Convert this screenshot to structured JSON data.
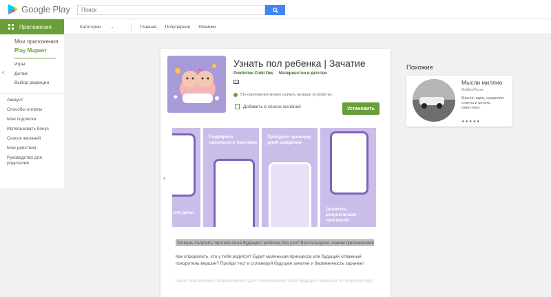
{
  "header": {
    "logo_text": "Google Play",
    "search_placeholder": "Поиск"
  },
  "subnav": {
    "apps_tab": "Приложения",
    "categories": "Категории",
    "links": [
      "Главная",
      "Популярное",
      "Новинки"
    ]
  },
  "sidebar": {
    "my_apps": "Мои приложения",
    "play_market": "Play Маркет",
    "items": [
      "Игры",
      "Детям",
      "Выбор редакции"
    ],
    "account_items": [
      "Аккаунт",
      "Способы оплаты",
      "Мои подписки",
      "Использовать бонус",
      "Список желаний",
      "Мои действия",
      "Руководство для родителей"
    ]
  },
  "app": {
    "title": "Узнать пол ребенка | Зачатие",
    "developer": "Predictive Child Dev",
    "category": "Материнство и детство",
    "age_rating": "3+",
    "availability": "Это приложение можно скачать на ваше устройство.",
    "wishlist": "Добавить в список желаний",
    "install": "Установить"
  },
  "screenshots": [
    {
      "caption": "ите даты"
    },
    {
      "caption": "Подберите идеального партнёра"
    },
    {
      "caption": "Пройдите проверку дней рождения"
    },
    {
      "caption": "Делитесь результатами прогнозов"
    }
  ],
  "description": {
    "highlight": "Хочешь получить прогноз пола будущего ребенка без узи? Воспользуйся нашим приложением",
    "paragraph": "Как определить, кто у тебя родится? Будет маленькая принцесса или будущий отважный покоритель вершин? Пройди тест и спланируй будущее зачатие и беременность заранее!",
    "faded": "Наше приложение предназначено для планирования пола будущего малыша по неделям еще"
  },
  "similar": {
    "title": "Похожие",
    "app_name": "Мысли миллио",
    "app_dev": "GoldenTenor",
    "app_desc": "Мысли, идеи, суждения, советы и цитаты известных",
    "rating": "★★★★★"
  },
  "colors": {
    "brand_green": "#689f38",
    "search_blue": "#4285f4",
    "icon_purple": "#a99ad8"
  }
}
